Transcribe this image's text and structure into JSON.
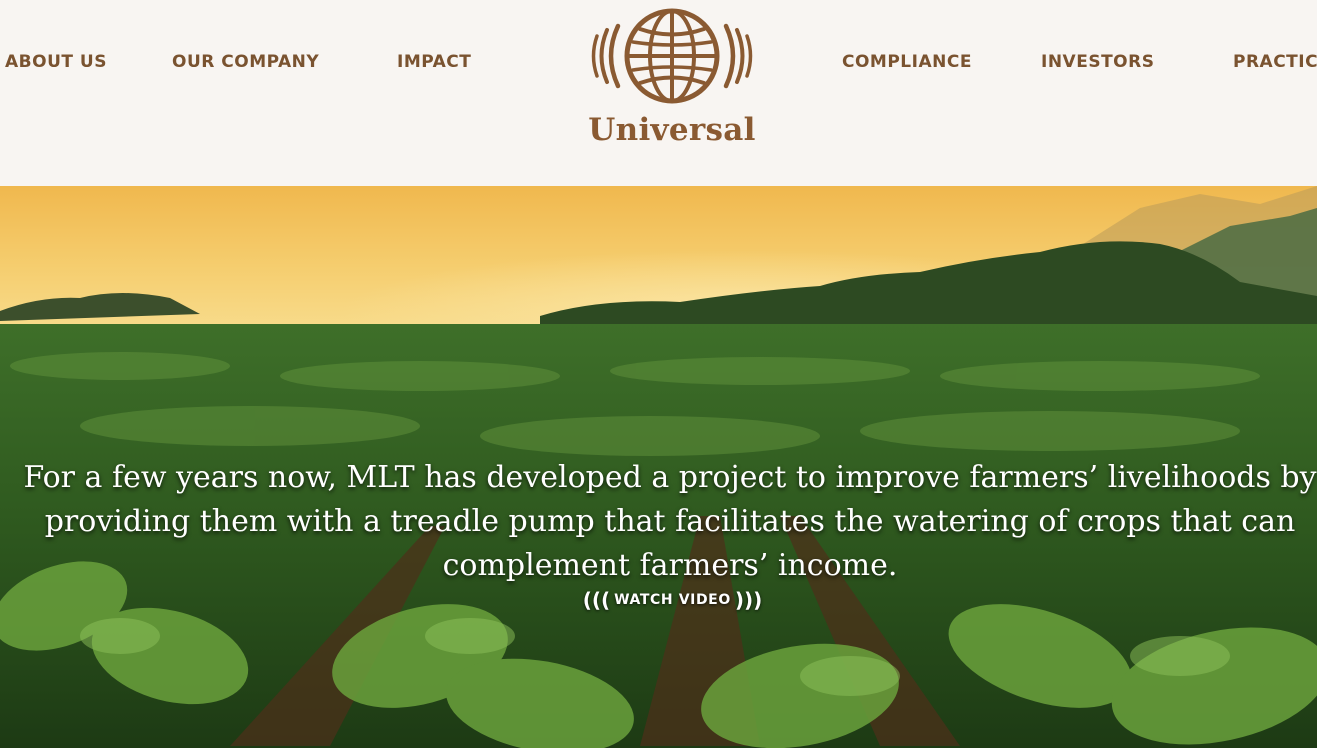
{
  "nav": {
    "about": "ABOUT US",
    "company": "OUR COMPANY",
    "impact": "IMPACT",
    "compliance": "COMPLIANCE",
    "investors": "INVESTORS",
    "practices": "PRACTICES"
  },
  "logo": {
    "wordmark": "Universal",
    "icon": "globe-icon"
  },
  "hero": {
    "headline": "For a few years now, MLT has developed a project to improve farmers’ livelihoods by providing them with a treadle pump that facilitates the watering of crops that can complement farmers’ income.",
    "watch_open": "(((",
    "watch_label": "WATCH VIDEO",
    "watch_close": ")))"
  },
  "colors": {
    "brand": "#7a5330",
    "header_bg": "#f8f5f2",
    "sky": "#f2c25f",
    "field": "#2e5a1e"
  }
}
